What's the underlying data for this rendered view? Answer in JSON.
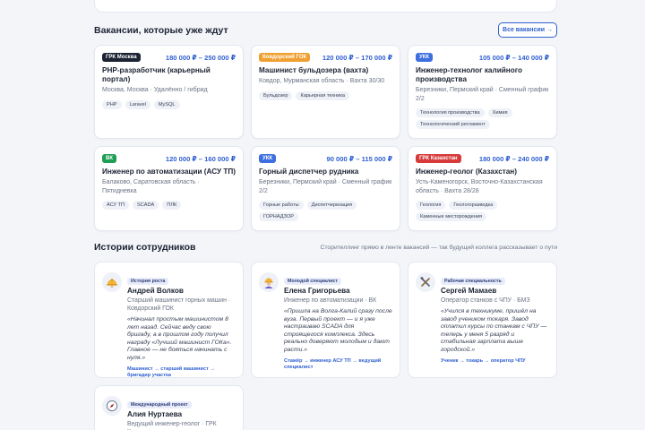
{
  "vacancies_section": {
    "title": "Вакансии, которые уже ждут",
    "all_button": "Все вакансии →"
  },
  "vacancies": [
    {
      "badge": "ГРК Москва",
      "badge_color": "#1c2333",
      "salary": "180 000 ₽ – 250 000 ₽",
      "title": "PHP-разработчик (карьерный портал)",
      "location": "Москва, Москва · Удалённо / гибрид",
      "tags": [
        "PHP",
        "Laravel",
        "MySQL"
      ]
    },
    {
      "badge": "Ковдорский ГОК",
      "badge_color": "#f0a030",
      "salary": "120 000 ₽ – 170 000 ₽",
      "title": "Машинист бульдозера (вахта)",
      "location": "Ковдор, Мурманская область · Вахта 30/30",
      "tags": [
        "Бульдозер",
        "Карьерная техника"
      ]
    },
    {
      "badge": "УКК",
      "badge_color": "#3d6fe0",
      "salary": "105 000 ₽ – 140 000 ₽",
      "title": "Инженер-технолог калийного производства",
      "location": "Березники, Пермский край · Сменный график 2/2",
      "tags": [
        "Технология производства",
        "Химия",
        "Технологический регламент"
      ]
    },
    {
      "badge": "ВК",
      "badge_color": "#1f9d55",
      "salary": "120 000 ₽ – 160 000 ₽",
      "title": "Инженер по автоматизации (АСУ ТП)",
      "location": "Балаково, Саратовская область · Пятидневка",
      "tags": [
        "АСУ ТП",
        "SCADA",
        "ПЛК"
      ]
    },
    {
      "badge": "УКК",
      "badge_color": "#3d6fe0",
      "salary": "90 000 ₽ – 115 000 ₽",
      "title": "Горный диспетчер рудника",
      "location": "Березники, Пермский край · Сменный график 2/2",
      "tags": [
        "Горные работы",
        "Диспетчеризация",
        "ГОРНАДЗОР"
      ]
    },
    {
      "badge": "ГРК Казахстан",
      "badge_color": "#d63a3a",
      "salary": "180 000 ₽ – 240 000 ₽",
      "title": "Инженер-геолог (Казахстан)",
      "location": "Усть-Каменогорск, Восточно-Казахстанская область · Вахта 28/28",
      "tags": [
        "Геология",
        "Геологоразведка",
        "Каменные месторождения"
      ]
    }
  ],
  "stories_section": {
    "title": "Истории сотрудников",
    "note": "Сторителлинг прямо в ленте вакансий — так будущий коллега рассказывает о пути"
  },
  "stories": [
    {
      "icon": "helmet-icon",
      "badge": "История роста",
      "name": "Андрей Волков",
      "role": "Старший машинист горных машин · Ковдорский ГОК",
      "quote": "«Начинал простым машинистом 8 лет назад. Сейчас веду свою бригаду, а в прошлом году получил награду «Лучший машинист ГОКа». Главное — не бояться начинать с нуля.»",
      "path": "Машинист → старший машинист → бригадир участка"
    },
    {
      "icon": "worker-icon",
      "badge": "Молодой специалист",
      "name": "Елена Григорьева",
      "role": "Инженер по автоматизации · ВК",
      "quote": "«Пришла на Волга-Калий сразу после вуза. Первый проект — и я уже настраиваю SCADA для строящегося комплекса. Здесь реально доверяют молодым и дают расти.»",
      "path": "Стажёр → инженер АСУ ТП → ведущий специалист"
    },
    {
      "icon": "tools-icon",
      "badge": "Рабочая специальность",
      "name": "Сергей Мамаев",
      "role": "Оператор станков с ЧПУ · БМЗ",
      "quote": "«Учился в техникуме, пришёл на завод учеником токаря. Завод оплатил курсы по станкам с ЧПУ — теперь у меня 5 разряд и стабильная зарплата выше городской.»",
      "path": "Ученик → токарь → оператор ЧПУ"
    },
    {
      "icon": "compass-icon",
      "badge": "Международный проект",
      "name": "Алия Нуртаева",
      "role": "Ведущий инженер-геолог · ГРК Казахстан",
      "quote": "",
      "path": ""
    }
  ]
}
